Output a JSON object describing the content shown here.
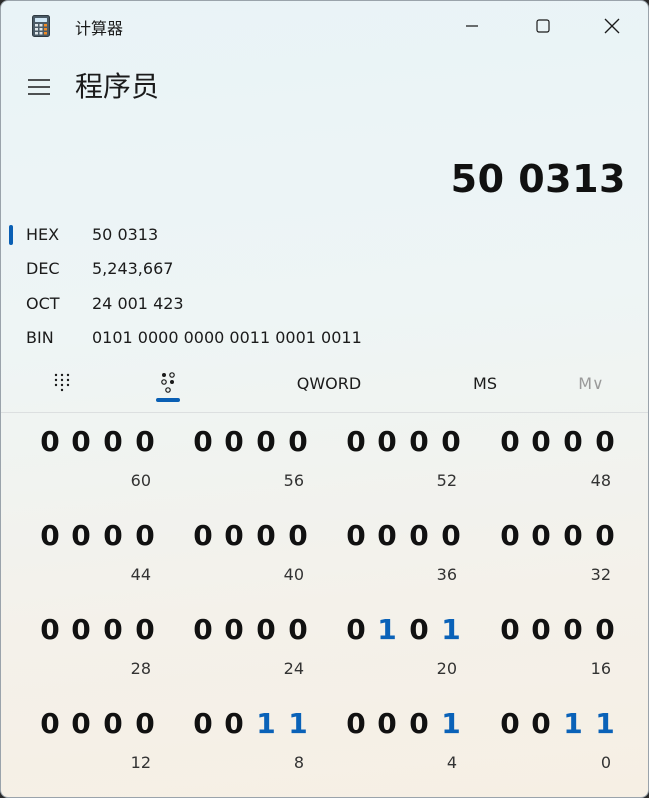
{
  "window": {
    "title": "计算器",
    "icon": "calculator-icon",
    "controls": [
      "minimize-icon",
      "maximize-icon",
      "close-icon"
    ]
  },
  "header": {
    "menu_icon": "hamburger-icon",
    "mode": "程序员"
  },
  "display": {
    "value": "50 0313"
  },
  "radix": [
    {
      "label": "HEX",
      "value": "50 0313",
      "selected": true
    },
    {
      "label": "DEC",
      "value": "5,243,667",
      "selected": false
    },
    {
      "label": "OCT",
      "value": "24 001 423",
      "selected": false
    },
    {
      "label": "BIN",
      "value": "0101 0000 0000 0011 0001 0011",
      "selected": false
    }
  ],
  "toolbar": {
    "keypad_icon": "full-keypad-icon",
    "bit_toggle_icon": "bit-toggling-keypad-icon",
    "word_size": "QWORD",
    "memory_store": "MS",
    "memory_menu": "M∨"
  },
  "bits": {
    "rows": [
      {
        "groups": [
          {
            "bits": [
              "0",
              "0",
              "0",
              "0"
            ],
            "label": "60"
          },
          {
            "bits": [
              "0",
              "0",
              "0",
              "0"
            ],
            "label": "56"
          },
          {
            "bits": [
              "0",
              "0",
              "0",
              "0"
            ],
            "label": "52"
          },
          {
            "bits": [
              "0",
              "0",
              "0",
              "0"
            ],
            "label": "48"
          }
        ]
      },
      {
        "groups": [
          {
            "bits": [
              "0",
              "0",
              "0",
              "0"
            ],
            "label": "44"
          },
          {
            "bits": [
              "0",
              "0",
              "0",
              "0"
            ],
            "label": "40"
          },
          {
            "bits": [
              "0",
              "0",
              "0",
              "0"
            ],
            "label": "36"
          },
          {
            "bits": [
              "0",
              "0",
              "0",
              "0"
            ],
            "label": "32"
          }
        ]
      },
      {
        "groups": [
          {
            "bits": [
              "0",
              "0",
              "0",
              "0"
            ],
            "label": "28"
          },
          {
            "bits": [
              "0",
              "0",
              "0",
              "0"
            ],
            "label": "24"
          },
          {
            "bits": [
              "0",
              "1",
              "0",
              "1"
            ],
            "label": "20"
          },
          {
            "bits": [
              "0",
              "0",
              "0",
              "0"
            ],
            "label": "16"
          }
        ]
      },
      {
        "groups": [
          {
            "bits": [
              "0",
              "0",
              "0",
              "0"
            ],
            "label": "12"
          },
          {
            "bits": [
              "0",
              "0",
              "1",
              "1"
            ],
            "label": "8"
          },
          {
            "bits": [
              "0",
              "0",
              "0",
              "1"
            ],
            "label": "4"
          },
          {
            "bits": [
              "0",
              "0",
              "1",
              "1"
            ],
            "label": "0"
          }
        ]
      }
    ]
  },
  "colors": {
    "accent": "#0a5fb4",
    "bit_on": "#0a62b8",
    "bit_off": "#111111"
  }
}
